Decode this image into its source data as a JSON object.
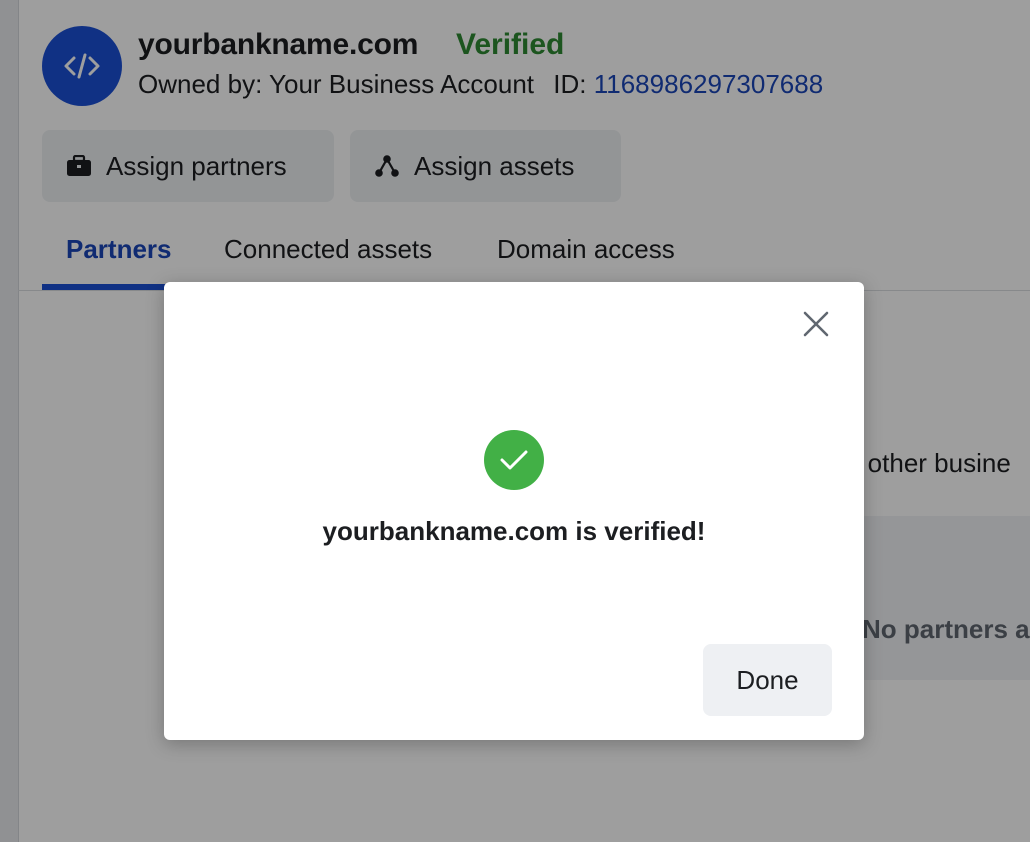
{
  "header": {
    "domain_name": "yourbankname.com",
    "status": "Verified",
    "owned_by": "Owned by: Your Business Account",
    "id_label": "ID:",
    "id_value": "1168986297307688"
  },
  "actions": {
    "assign_partners": "Assign partners",
    "assign_assets": "Assign assets"
  },
  "tabs": [
    {
      "label": "Partners",
      "active": true
    },
    {
      "label": "Connected assets",
      "active": false
    },
    {
      "label": "Domain access",
      "active": false
    }
  ],
  "background": {
    "partial_text": "h other busine",
    "empty_state": "No partners a"
  },
  "modal": {
    "message": "yourbankname.com is verified!",
    "done_label": "Done"
  },
  "colors": {
    "accent": "#1b4fd6",
    "verified": "#2e8a32",
    "success": "#42b046",
    "link": "#1b46b8"
  },
  "icons": {
    "domain": "code-icon",
    "assign_partners": "briefcase-icon",
    "assign_assets": "assets-nodes-icon",
    "close": "close-icon",
    "success": "checkmark-icon"
  }
}
